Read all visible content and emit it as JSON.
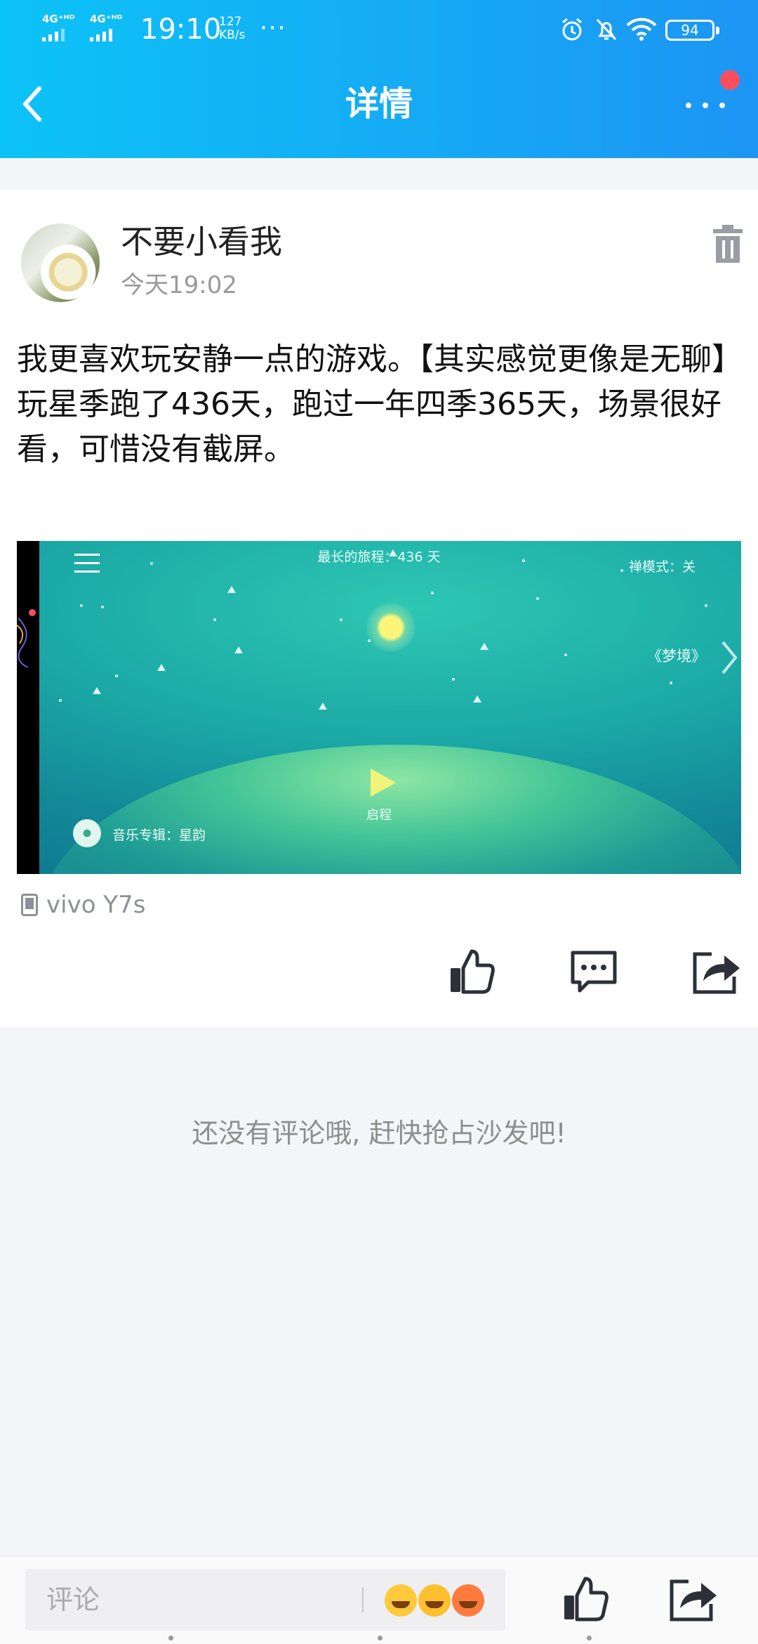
{
  "status_bar": {
    "network1": "4G⁺ᴴᴰ",
    "network2": "4G⁺ᴴᴰ",
    "time": "19:10",
    "speed_value": "127",
    "speed_unit": "KB/s",
    "more": "···",
    "battery": "94",
    "icons": [
      "alarm-icon",
      "mute-bell-icon",
      "wifi-icon",
      "battery-icon"
    ]
  },
  "header": {
    "title": "详情",
    "colors": {
      "gradient_start": "#0cc3f6",
      "gradient_end": "#1c95f4",
      "badge": "#ff4d5e"
    }
  },
  "post": {
    "username": "不要小看我",
    "time": "今天19:02",
    "content": "我更喜欢玩安静一点的游戏。【其实感觉更像是无聊】\n玩星季跑了436天，跑过一年四季365天，场景很好看，可惜没有截屏。",
    "device": "vivo Y7s",
    "screenshot": {
      "journey": "最长的旅程：436 天",
      "zen_mode": "禅模式：关",
      "dream": "《梦境》",
      "start": "启程",
      "album": "音乐专辑：星韵"
    }
  },
  "comments": {
    "empty_text": "还没有评论哦, 赶快抢占沙发吧!"
  },
  "bottom_bar": {
    "comment_placeholder": "评论"
  }
}
